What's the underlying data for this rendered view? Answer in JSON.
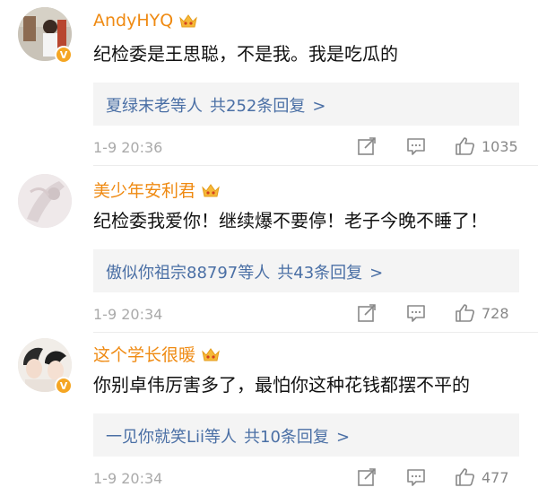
{
  "comments": [
    {
      "username": "AndyHYQ",
      "text": "纪检委是王思聪，不是我。我是吃瓜的",
      "replies_names": "夏绿末老等人",
      "replies_count": "共252条回复",
      "arrow": ">",
      "time": "1-9 20:36",
      "likes": "1035",
      "badge": "V"
    },
    {
      "username": "美少年安利君",
      "text": "纪检委我爱你！继续爆不要停！老子今晚不睡了！",
      "replies_names": "傲似你祖宗88797等人",
      "replies_count": "共43条回复",
      "arrow": ">",
      "time": "1-9 20:34",
      "likes": "728",
      "badge": ""
    },
    {
      "username": "这个学长很暖",
      "text": "你别卓伟厉害多了，最怕你这种花钱都摆不平的",
      "replies_names": "一见你就笑Lii等人",
      "replies_count": "共10条回复",
      "arrow": ">",
      "time": "1-9 20:34",
      "likes": "477",
      "badge": "V"
    }
  ],
  "colors": {
    "username": "#ef8a12",
    "reply_link": "#4a6fa5",
    "reply_bg": "#f4f4f4",
    "meta": "#aaaaaa",
    "icon": "#888888",
    "badge": "#f5a623"
  },
  "icons": [
    "crown-icon",
    "verified-badge-icon",
    "share-icon",
    "comment-icon",
    "like-icon"
  ]
}
